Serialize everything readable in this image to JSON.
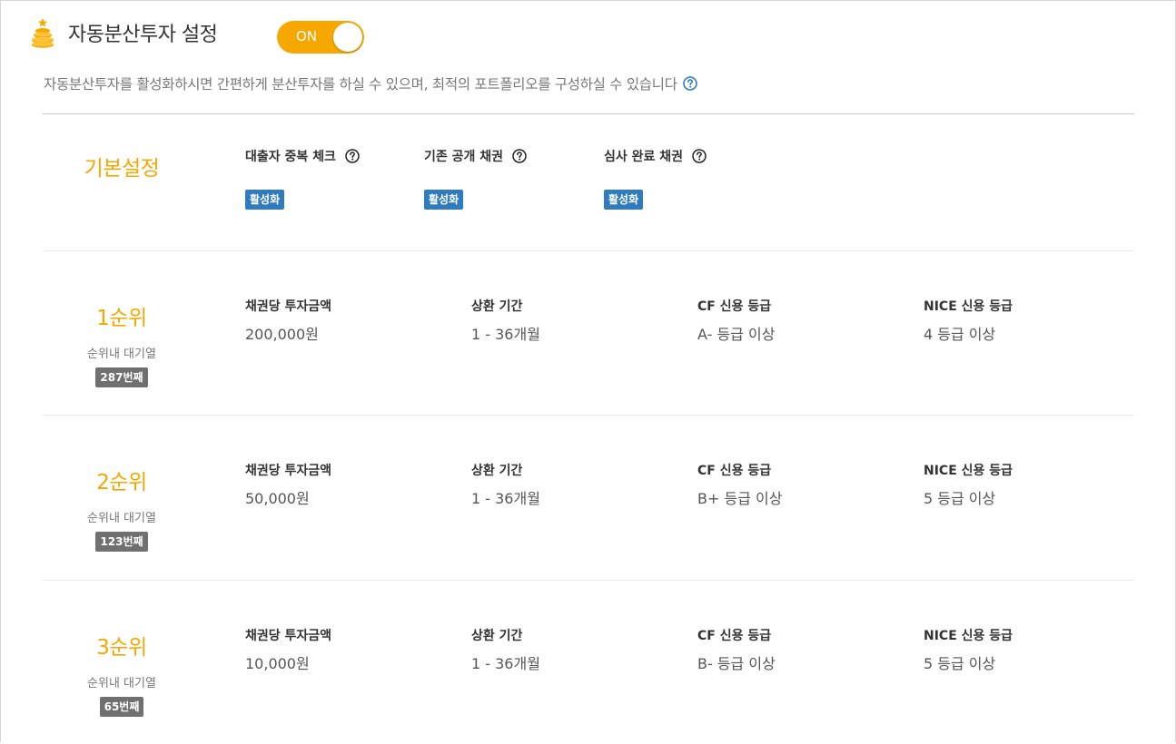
{
  "header": {
    "title": "자동분산투자 설정",
    "toggle_label": "ON",
    "description": "자동분산투자를 활성화하시면 간편하게 분산투자를 하실 수 있으며, 최적의 포트폴리오를 구성하실 수 있습니다"
  },
  "basic": {
    "label": "기본설정",
    "options": [
      {
        "title": "대출자 중복 체크",
        "status": "활성화"
      },
      {
        "title": "기존 공개 채권",
        "status": "활성화"
      },
      {
        "title": "심사 완료 채권",
        "status": "활성화"
      }
    ]
  },
  "field_labels": {
    "amount": "채권당 투자금액",
    "period": "상환 기간",
    "cf_grade": "CF 신용 등급",
    "nice_grade": "NICE 신용 등급"
  },
  "queue_label": "순위내 대기열",
  "ranks": [
    {
      "rank": "1순위",
      "queue": "287번째",
      "amount": "200,000원",
      "period": "1 - 36개월",
      "cf_grade": "A- 등급 이상",
      "nice_grade": "4 등급 이상"
    },
    {
      "rank": "2순위",
      "queue": "123번째",
      "amount": "50,000원",
      "period": "1 - 36개월",
      "cf_grade": "B+ 등급 이상",
      "nice_grade": "5 등급 이상"
    },
    {
      "rank": "3순위",
      "queue": "65번째",
      "amount": "10,000원",
      "period": "1 - 36개월",
      "cf_grade": "B- 등급 이상",
      "nice_grade": "5 등급 이상"
    }
  ],
  "colors": {
    "accent": "#f6a800",
    "badge_blue": "#2f7bbf",
    "badge_gray": "#707070"
  },
  "icons": {
    "header": "coin-stack-icon",
    "help": "question-circle-icon"
  }
}
